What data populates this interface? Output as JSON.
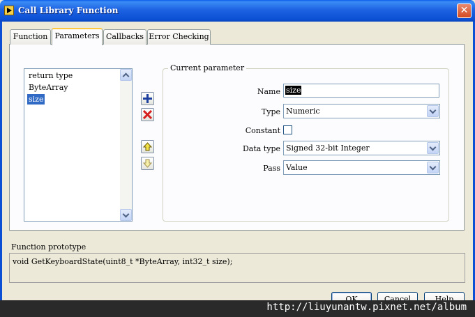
{
  "window": {
    "title": "Call Library Function",
    "close_glyph": "✕"
  },
  "tabs": [
    {
      "label": "Function"
    },
    {
      "label": "Parameters",
      "active": true
    },
    {
      "label": "Callbacks"
    },
    {
      "label": "Error Checking"
    }
  ],
  "parameters": {
    "items": [
      "return type",
      "ByteArray",
      "size"
    ],
    "selected": "size"
  },
  "current_parameter": {
    "group_title": "Current parameter",
    "name_label": "Name",
    "name_value": "size",
    "type_label": "Type",
    "type_value": "Numeric",
    "constant_label": "Constant",
    "constant_checked": false,
    "data_type_label": "Data type",
    "data_type_value": "Signed 32-bit Integer",
    "pass_label": "Pass",
    "pass_value": "Value"
  },
  "prototype": {
    "label": "Function prototype",
    "text": "void  GetKeyboardState(uint8_t *ByteArray, int32_t size);"
  },
  "buttons": {
    "ok": "OK",
    "cancel": "Cancel",
    "help": "Help"
  },
  "watermark": "http://liuyunantw.pixnet.net/album",
  "colors": {
    "titlebar": "#0b4fd4",
    "selection": "#316ac5",
    "tab_highlight": "#ffc83c"
  }
}
